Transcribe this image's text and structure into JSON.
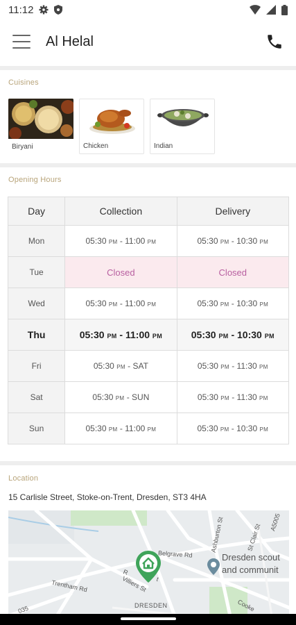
{
  "status": {
    "time": "11:12"
  },
  "app": {
    "title": "Al Helal"
  },
  "cuisines": {
    "heading": "Cuisines",
    "items": [
      {
        "name": "Biryani",
        "icon": "biryani-dish"
      },
      {
        "name": "Chicken",
        "icon": "roast-chicken"
      },
      {
        "name": "Indian",
        "icon": "curry-bowl"
      }
    ]
  },
  "hours": {
    "heading": "Opening Hours",
    "columns": {
      "day": "Day",
      "collection": "Collection",
      "delivery": "Delivery"
    },
    "rows": [
      {
        "day": "Mon",
        "collection": [
          "05:30",
          "PM",
          " - 11:00",
          "PM"
        ],
        "delivery": [
          "05:30",
          "PM",
          " - 10:30",
          "PM"
        ]
      },
      {
        "day": "Tue",
        "collection_closed": "Closed",
        "delivery_closed": "Closed"
      },
      {
        "day": "Wed",
        "collection": [
          "05:30",
          "PM",
          " - 11:00",
          "PM"
        ],
        "delivery": [
          "05:30",
          "PM",
          " - 10:30",
          "PM"
        ]
      },
      {
        "day": "Thu",
        "collection": [
          "05:30",
          "PM",
          " - 11:00",
          "PM"
        ],
        "delivery": [
          "05:30",
          "PM",
          " - 10:30",
          "PM"
        ]
      },
      {
        "day": "Fri",
        "collection": [
          "05:30",
          "PM",
          " - SAT",
          ""
        ],
        "delivery": [
          "05:30",
          "PM",
          " - 11:30",
          "PM"
        ]
      },
      {
        "day": "Sat",
        "collection": [
          "05:30",
          "PM",
          " - SUN",
          ""
        ],
        "delivery": [
          "05:30",
          "PM",
          " - 11:30",
          "PM"
        ]
      },
      {
        "day": "Sun",
        "collection": [
          "05:30",
          "PM",
          " - 11:00",
          "PM"
        ],
        "delivery": [
          "05:30",
          "PM",
          " - 10:30",
          "PM"
        ]
      }
    ],
    "today": "Thu"
  },
  "location": {
    "heading": "Location",
    "address": "15 Carlisle Street, Stoke-on-Trent, Dresden, ST3 4HA",
    "map_labels": {
      "belgrave": "Belgrave Rd",
      "trentham": "Trentham Rd",
      "villiers": "Villiers St",
      "dresden": "DRESDEN",
      "scout": "Dresden scout",
      "community": "and communit",
      "st_clair": "St Clair St",
      "ashburton": "Ashburton St",
      "a5005": "A5005",
      "cooke": "Cooke",
      "r_st": "R",
      "t_st": "t",
      "a5035": "035"
    }
  },
  "colors": {
    "accent_label": "#b8a47a",
    "closed_bg": "#fbeaee",
    "closed_text": "#b85fa0",
    "map_pin": "#3fa45a"
  }
}
